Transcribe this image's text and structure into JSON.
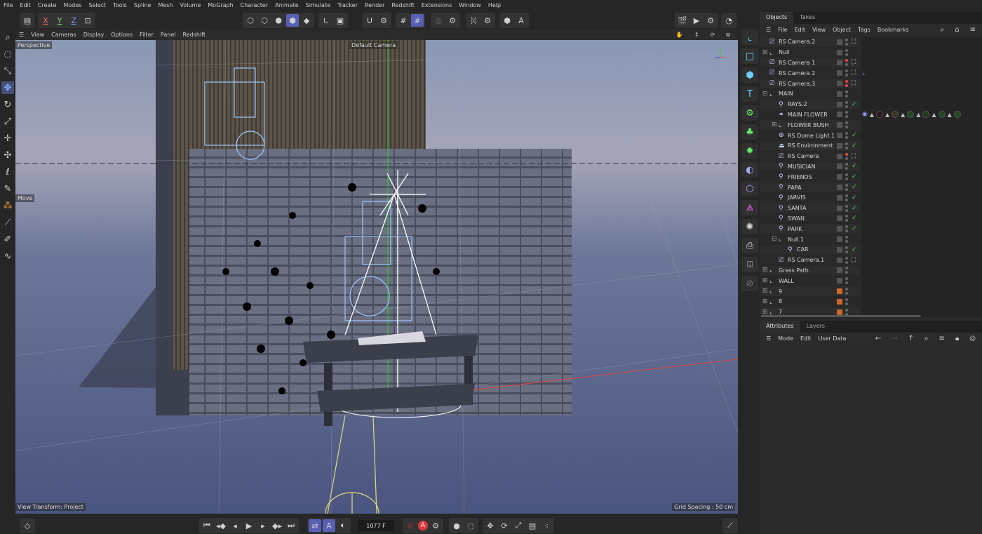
{
  "menu": [
    "File",
    "Edit",
    "Create",
    "Modes",
    "Select",
    "Tools",
    "Spline",
    "Mesh",
    "Volume",
    "MoGraph",
    "Character",
    "Animate",
    "Simulate",
    "Tracker",
    "Render",
    "Redshift",
    "Extensions",
    "Window",
    "Help"
  ],
  "axes": {
    "x": "X",
    "y": "Y",
    "z": "Z"
  },
  "viewport_menu": [
    "View",
    "Cameras",
    "Display",
    "Options",
    "Filter",
    "Panel",
    "Redshift"
  ],
  "viewport": {
    "name": "Perspective",
    "camera": "Default Camera",
    "tool": "Move",
    "view_transform": "View Transform: Project",
    "grid_spacing": "Grid Spacing : 50 cm"
  },
  "objects_panel": {
    "tabs": [
      "Objects",
      "Takes"
    ],
    "menu": [
      "File",
      "Edit",
      "View",
      "Object",
      "Tags",
      "Bookmarks"
    ],
    "rows": [
      {
        "name": "RS Camera.2",
        "icon": "camera",
        "level": 0,
        "dots": [
          "",
          ""
        ],
        "tag": "target"
      },
      {
        "name": "Null",
        "icon": "null",
        "level": 0,
        "expand": "+"
      },
      {
        "name": "RS Camera 1",
        "icon": "camera",
        "level": 0,
        "dots": [
          "red",
          ""
        ],
        "tag": "target"
      },
      {
        "name": "RS Camera 2",
        "icon": "camera",
        "level": 0,
        "tag": "target",
        "extra": "protection-tag"
      },
      {
        "name": "RS Camera.3",
        "icon": "camera",
        "level": 0,
        "dots": [
          "red",
          "red"
        ],
        "tag": "target"
      },
      {
        "name": "MAIN",
        "icon": "null",
        "level": 0,
        "expand": "-"
      },
      {
        "name": "RAYS.2",
        "icon": "emitter",
        "level": 1,
        "tag": "check"
      },
      {
        "name": "MAIN FLOWER",
        "icon": "flower",
        "level": 1,
        "extra": "materials"
      },
      {
        "name": "FLOWER BUSH",
        "icon": "null",
        "level": 1,
        "expand": "+"
      },
      {
        "name": "RS Dome Light.1",
        "icon": "globe",
        "level": 1,
        "tag": "check"
      },
      {
        "name": "RS Environment",
        "icon": "environment",
        "level": 1,
        "tag": "check"
      },
      {
        "name": "RS Camera",
        "icon": "camera",
        "level": 1,
        "dots": [
          "red",
          ""
        ],
        "tag": "target"
      },
      {
        "name": "MUSICIAN",
        "icon": "emitter",
        "level": 1,
        "tag": "check"
      },
      {
        "name": "FRIENDS",
        "icon": "emitter",
        "level": 1,
        "tag": "check"
      },
      {
        "name": "PAPA",
        "icon": "emitter",
        "level": 1,
        "tag": "check"
      },
      {
        "name": "JARVIS",
        "icon": "emitter",
        "level": 1,
        "tag": "check"
      },
      {
        "name": "SANTA",
        "icon": "emitter",
        "level": 1,
        "tag": "check"
      },
      {
        "name": "SWAN",
        "icon": "emitter",
        "level": 1,
        "tag": "check"
      },
      {
        "name": "PARK",
        "icon": "emitter",
        "level": 1,
        "tag": "check"
      },
      {
        "name": "Null.1",
        "icon": "null",
        "level": 1,
        "expand": "-"
      },
      {
        "name": "CAR",
        "icon": "emitter",
        "level": 2,
        "tag": "check"
      },
      {
        "name": "RS Camera.1",
        "icon": "camera",
        "level": 1,
        "tag": "target"
      },
      {
        "name": "Grass Path",
        "icon": "null",
        "level": 0,
        "expand": "+"
      },
      {
        "name": "WALL",
        "icon": "null",
        "level": 0,
        "expand": "+"
      },
      {
        "name": "9",
        "icon": "null",
        "level": 0,
        "expand": "+",
        "layer": "#d0652a"
      },
      {
        "name": "8",
        "icon": "null",
        "level": 0,
        "expand": "+",
        "layer": "#d0652a"
      },
      {
        "name": "7",
        "icon": "null",
        "level": 0,
        "expand": "+",
        "layer": "#d0652a"
      }
    ]
  },
  "attributes_panel": {
    "tabs": [
      "Attributes",
      "Layers"
    ],
    "menu": [
      "Mode",
      "Edit",
      "User Data"
    ]
  },
  "timeline": {
    "current_frame": "1077 F"
  },
  "colors": {
    "accent": "#5a5fb5",
    "check": "#4cd964",
    "layer_orange": "#d0652a",
    "record": "#e0393e"
  }
}
